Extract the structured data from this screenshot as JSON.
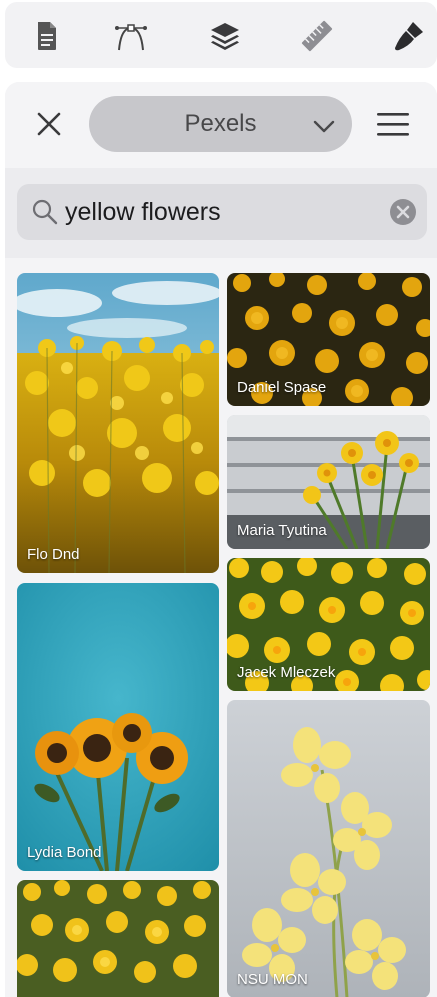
{
  "toolbar": {
    "tools": [
      {
        "icon": "document-icon"
      },
      {
        "icon": "pen-path-icon"
      },
      {
        "icon": "layers-icon"
      },
      {
        "icon": "ruler-icon"
      },
      {
        "icon": "brush-icon"
      }
    ]
  },
  "panel": {
    "source": "Pexels",
    "search": {
      "value": "yellow flowers"
    }
  },
  "photos": [
    {
      "author": "Flo Dnd"
    },
    {
      "author": "Daniel Spase"
    },
    {
      "author": "Maria Tyutina"
    },
    {
      "author": "Jacek Mleczek"
    },
    {
      "author": "Lydia Bond"
    },
    {
      "author": "NSU MON"
    },
    {
      "author": ""
    }
  ],
  "colors": {
    "accent_yellow": "#e6b90e",
    "sky_blue": "#8ec8e0",
    "teal": "#2aa3be",
    "panel_bg": "#f4f4f6"
  }
}
